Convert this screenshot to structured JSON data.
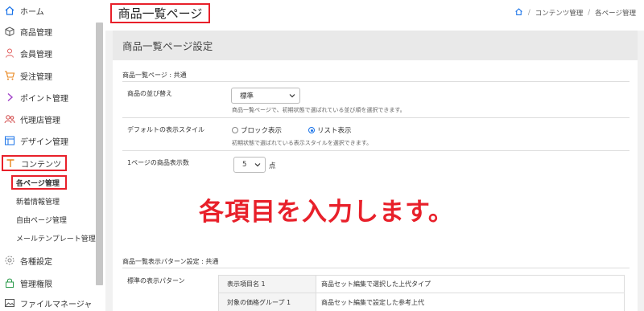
{
  "sidebar": {
    "items": [
      {
        "label": "ホーム",
        "icon": "home-icon"
      },
      {
        "label": "商品管理",
        "icon": "box-icon"
      },
      {
        "label": "会員管理",
        "icon": "user-icon"
      },
      {
        "label": "受注管理",
        "icon": "cart-icon"
      },
      {
        "label": "ポイント管理",
        "icon": "chevron-right-icon"
      },
      {
        "label": "代理店管理",
        "icon": "users-icon"
      },
      {
        "label": "デザイン管理",
        "icon": "layout-icon"
      },
      {
        "label": "コンテンツ",
        "icon": "text-icon"
      }
    ],
    "sub_items": [
      {
        "label": "各ページ管理"
      },
      {
        "label": "新着情報管理"
      },
      {
        "label": "自由ページ管理"
      },
      {
        "label": "メールテンプレート管理"
      }
    ],
    "bottom_items": [
      {
        "label": "各種設定",
        "icon": "gear-icon"
      },
      {
        "label": "管理権限",
        "icon": "lock-icon"
      },
      {
        "label": "ファイルマネージャ",
        "icon": "image-icon"
      }
    ]
  },
  "header": {
    "title": "商品一覧ページ",
    "breadcrumb": [
      "コンテンツ管理",
      "各ページ管理"
    ]
  },
  "card": {
    "title": "商品一覧ページ設定",
    "section1": "商品一覧ページ : 共通",
    "rows": {
      "sort": {
        "label": "商品の並び替え",
        "value": "標準",
        "help": "商品一覧ページで、初期状態で選ばれている並び順を選択できます。"
      },
      "display": {
        "label": "デフォルトの表示スタイル",
        "options": [
          "ブロック表示",
          "リスト表示"
        ],
        "selected": "リスト表示",
        "help": "初期状態で選ばれている表示スタイルを選択できます。"
      },
      "count": {
        "label": "1ページの商品表示数",
        "value": "5",
        "unit": "点"
      }
    },
    "section2": "商品一覧表示パターン設定 : 共通",
    "pattern_label": "標準の表示パターン",
    "pattern_rows": [
      {
        "name": "表示項目名 1",
        "value": "商品セット編集で選択した上代タイプ"
      },
      {
        "name": "対象の価格グループ 1",
        "value": "商品セット編集で設定した参考上代"
      }
    ]
  },
  "overlay_text": "各項目を入力します。",
  "colors": {
    "highlight": "#e8202a",
    "accent": "#1a73e8"
  }
}
